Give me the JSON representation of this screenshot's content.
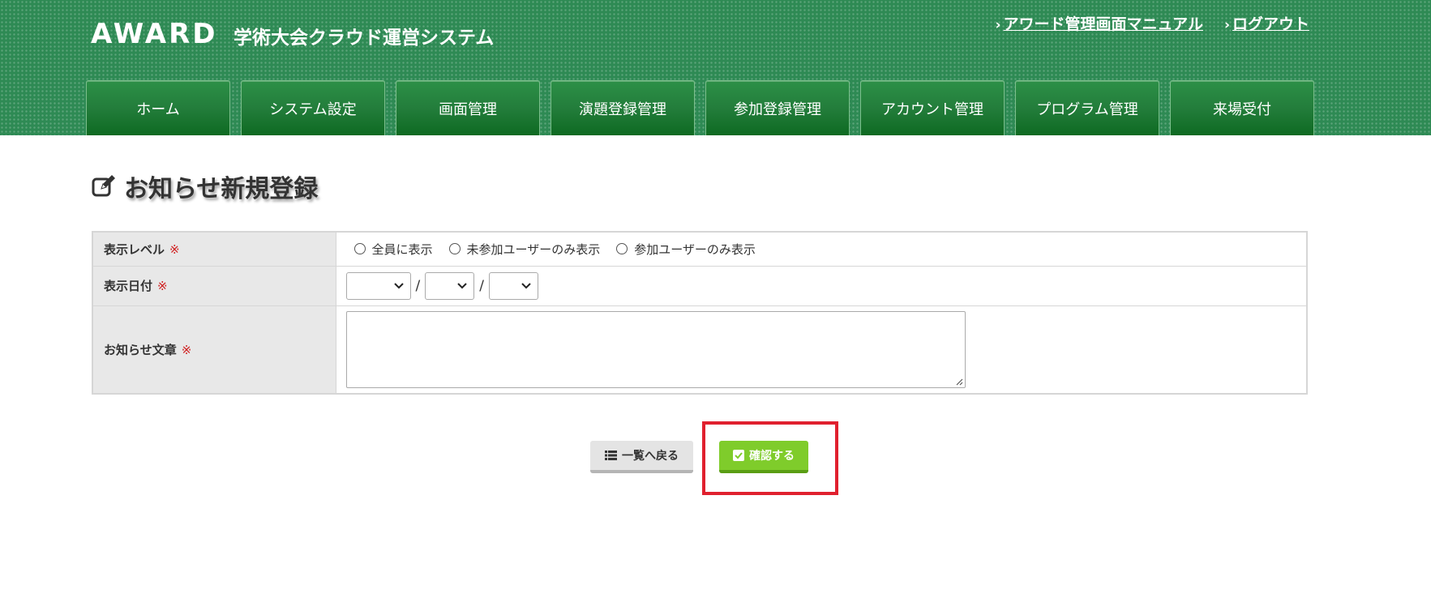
{
  "header": {
    "logo": "AWARD",
    "system_title": "学術大会クラウド運営システム",
    "links": [
      {
        "label": "アワード管理画面マニュアル",
        "icon": "chevron-right-icon"
      },
      {
        "label": "ログアウト",
        "icon": "chevron-right-icon"
      }
    ]
  },
  "nav": {
    "tabs": [
      "ホーム",
      "システム設定",
      "画面管理",
      "演題登録管理",
      "参加登録管理",
      "アカウント管理",
      "プログラム管理",
      "来場受付"
    ]
  },
  "page": {
    "title": "お知らせ新規登録",
    "title_icon": "edit-icon"
  },
  "form": {
    "required_mark": "※",
    "display_level": {
      "label": "表示レベル",
      "options": [
        "全員に表示",
        "未参加ユーザーのみ表示",
        "参加ユーザーのみ表示"
      ]
    },
    "display_date": {
      "label": "表示日付",
      "separator": "/",
      "year": "",
      "month": "",
      "day": ""
    },
    "notice_text": {
      "label": "お知らせ文章",
      "value": ""
    }
  },
  "buttons": {
    "back": {
      "label": "一覧へ戻る",
      "icon": "list-icon"
    },
    "confirm": {
      "label": "確認する",
      "icon": "checkbox-icon"
    }
  },
  "colors": {
    "header_green": "#2e8a54",
    "nav_green": "#237d3b",
    "confirm_green": "#7fcc2b",
    "required_red": "#d01f1f",
    "highlight_red": "#e0202e"
  }
}
